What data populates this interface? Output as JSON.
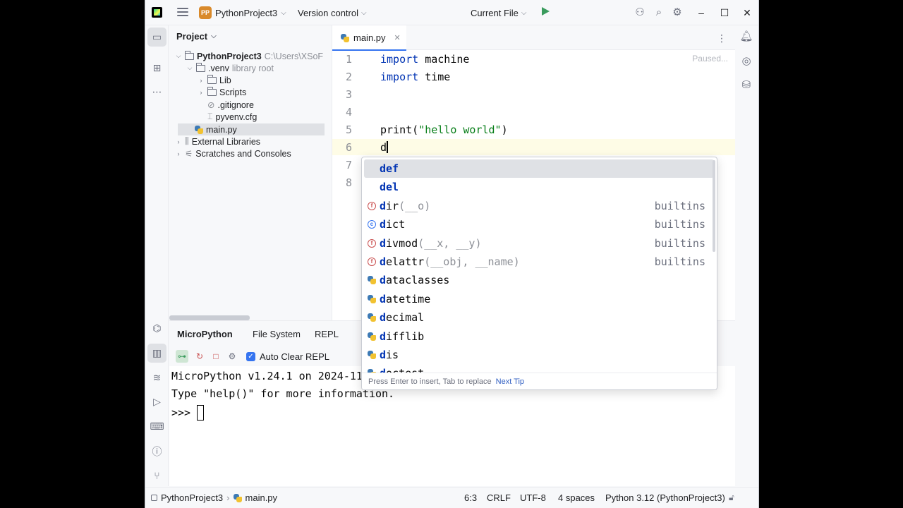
{
  "titlebar": {
    "project_badge": "PP",
    "project_name": "PythonProject3",
    "vcs": "Version control",
    "run_config": "Current File"
  },
  "project_panel": {
    "title": "Project",
    "tree": [
      {
        "label": "PythonProject3",
        "hint": "C:\\Users\\XSoF"
      },
      {
        "label": ".venv",
        "hint": "library root"
      },
      {
        "label": "Lib"
      },
      {
        "label": "Scripts"
      },
      {
        "label": ".gitignore"
      },
      {
        "label": "pyvenv.cfg"
      },
      {
        "label": "main.py"
      },
      {
        "label": "External Libraries"
      },
      {
        "label": "Scratches and Consoles"
      }
    ]
  },
  "editor": {
    "tab_label": "main.py",
    "status_hint": "Paused...",
    "line_numbers": [
      "1",
      "2",
      "3",
      "4",
      "5",
      "6",
      "7",
      "8"
    ],
    "code": {
      "l1_kw": "import",
      "l1_rest": " machine",
      "l2_kw": "import",
      "l2_rest": " time",
      "l5_fn": "print(",
      "l5_str": "\"hello world\"",
      "l5_end": ")",
      "l6": "d"
    }
  },
  "completion": {
    "items": [
      {
        "match": "d",
        "rest": "ef",
        "params": "",
        "type": "",
        "icon": "keyword"
      },
      {
        "match": "d",
        "rest": "el",
        "params": "",
        "type": "",
        "icon": "keyword"
      },
      {
        "match": "d",
        "rest": "ir",
        "params": "(__o)",
        "type": "builtins",
        "icon": "function-icon"
      },
      {
        "match": "d",
        "rest": "ict",
        "params": "",
        "type": "builtins",
        "icon": "class-icon"
      },
      {
        "match": "d",
        "rest": "ivmod",
        "params": "(__x, __y)",
        "type": "builtins",
        "icon": "function-icon"
      },
      {
        "match": "d",
        "rest": "elattr",
        "params": "(__obj, __name)",
        "type": "builtins",
        "icon": "function-icon"
      },
      {
        "match": "d",
        "rest": "ataclasses",
        "params": "",
        "type": "",
        "icon": "python-icon"
      },
      {
        "match": "d",
        "rest": "atetime",
        "params": "",
        "type": "",
        "icon": "python-icon"
      },
      {
        "match": "d",
        "rest": "ecimal",
        "params": "",
        "type": "",
        "icon": "python-icon"
      },
      {
        "match": "d",
        "rest": "ifflib",
        "params": "",
        "type": "",
        "icon": "python-icon"
      },
      {
        "match": "d",
        "rest": "is",
        "params": "",
        "type": "",
        "icon": "python-icon"
      },
      {
        "match": "d",
        "rest": "octest",
        "params": "",
        "type": "",
        "icon": "python-icon"
      }
    ],
    "footer_hint": "Press Enter to insert, Tab to replace",
    "footer_link": "Next Tip"
  },
  "bottom_panel": {
    "title": "MicroPython",
    "tabs": [
      "File System",
      "REPL"
    ],
    "auto_clear_label": "Auto Clear REPL",
    "terminal": {
      "line1": "MicroPython v1.24.1 on 2024-11",
      "line2": "Type \"help()\" for more information.",
      "prompt": ">>> "
    }
  },
  "statusbar": {
    "project": "PythonProject3",
    "file": "main.py",
    "position": "6:3",
    "line_sep": "CRLF",
    "encoding": "UTF-8",
    "indent": "4 spaces",
    "interpreter": "Python 3.12 (PythonProject3)"
  },
  "colors": {
    "accent": "#3574f0",
    "keyword": "#0033b3",
    "string": "#067d17",
    "run": "#3a9b5d"
  }
}
